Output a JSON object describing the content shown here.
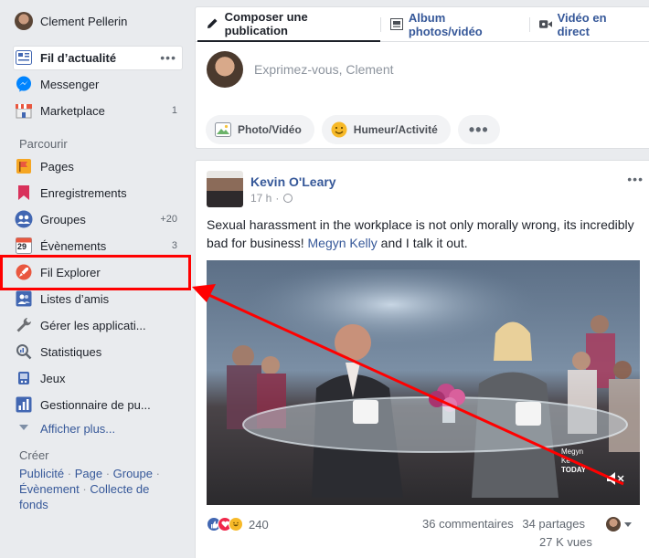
{
  "sidebar": {
    "user_name": "Clement Pellerin",
    "items": [
      {
        "label": "Fil d’actualité",
        "icon": "news-feed-icon",
        "count": ""
      },
      {
        "label": "Messenger",
        "icon": "messenger-icon",
        "count": ""
      },
      {
        "label": "Marketplace",
        "icon": "marketplace-icon",
        "count": "1"
      }
    ],
    "explore_heading": "Parcourir",
    "explore_items": [
      {
        "label": "Pages",
        "icon": "pages-flag-icon",
        "count": ""
      },
      {
        "label": "Enregistrements",
        "icon": "bookmark-icon",
        "count": ""
      },
      {
        "label": "Groupes",
        "icon": "groups-icon",
        "count": "+20"
      },
      {
        "label": "Évènements",
        "icon": "calendar-icon",
        "count": "3",
        "calendar_day": "29"
      },
      {
        "label": "Fil Explorer",
        "icon": "rocket-icon",
        "count": ""
      },
      {
        "label": "Listes d’amis",
        "icon": "friend-list-icon",
        "count": ""
      },
      {
        "label": "Gérer les applicati...",
        "icon": "wrench-icon",
        "count": ""
      },
      {
        "label": "Statistiques",
        "icon": "statistics-icon",
        "count": ""
      },
      {
        "label": "Jeux",
        "icon": "games-icon",
        "count": ""
      },
      {
        "label": "Gestionnaire de pu...",
        "icon": "ads-manager-icon",
        "count": ""
      }
    ],
    "show_more": "Afficher plus...",
    "create_heading": "Créer",
    "create_links": [
      "Publicité",
      "Page",
      "Groupe",
      "Évènement",
      "Collecte de fonds"
    ],
    "create_separator": " · "
  },
  "composer": {
    "tabs": [
      {
        "label": "Composer une publication",
        "icon": "pencil-icon"
      },
      {
        "label": "Album photos/vidéo",
        "icon": "album-icon"
      },
      {
        "label": "Vidéo en direct",
        "icon": "video-camera-icon"
      }
    ],
    "placeholder": "Exprimez-vous, Clement",
    "actions": [
      {
        "label": "Photo/Vidéo",
        "icon": "photo-icon"
      },
      {
        "label": "Humeur/Activité",
        "icon": "smiley-icon"
      }
    ],
    "more_label": "•••"
  },
  "post": {
    "author": "Kevin O'Leary",
    "time": "17 h",
    "menu_label": "•••",
    "text_before": "Sexual harassment in the workplace is not only morally wrong, its incredibly bad for business! ",
    "mention": "Megyn Kelly",
    "text_after": " and I talk it out.",
    "video_overlay_text": [
      "Megyn",
      "Ke",
      "TODAY"
    ],
    "reaction_count": "240",
    "comments": "36 commentaires",
    "shares": "34 partages",
    "views": "27 K vues"
  },
  "annotation": {
    "color": "#ff0000"
  },
  "colors": {
    "link": "#365899",
    "background": "#e9ebee",
    "accent_red": "#ff0000"
  }
}
